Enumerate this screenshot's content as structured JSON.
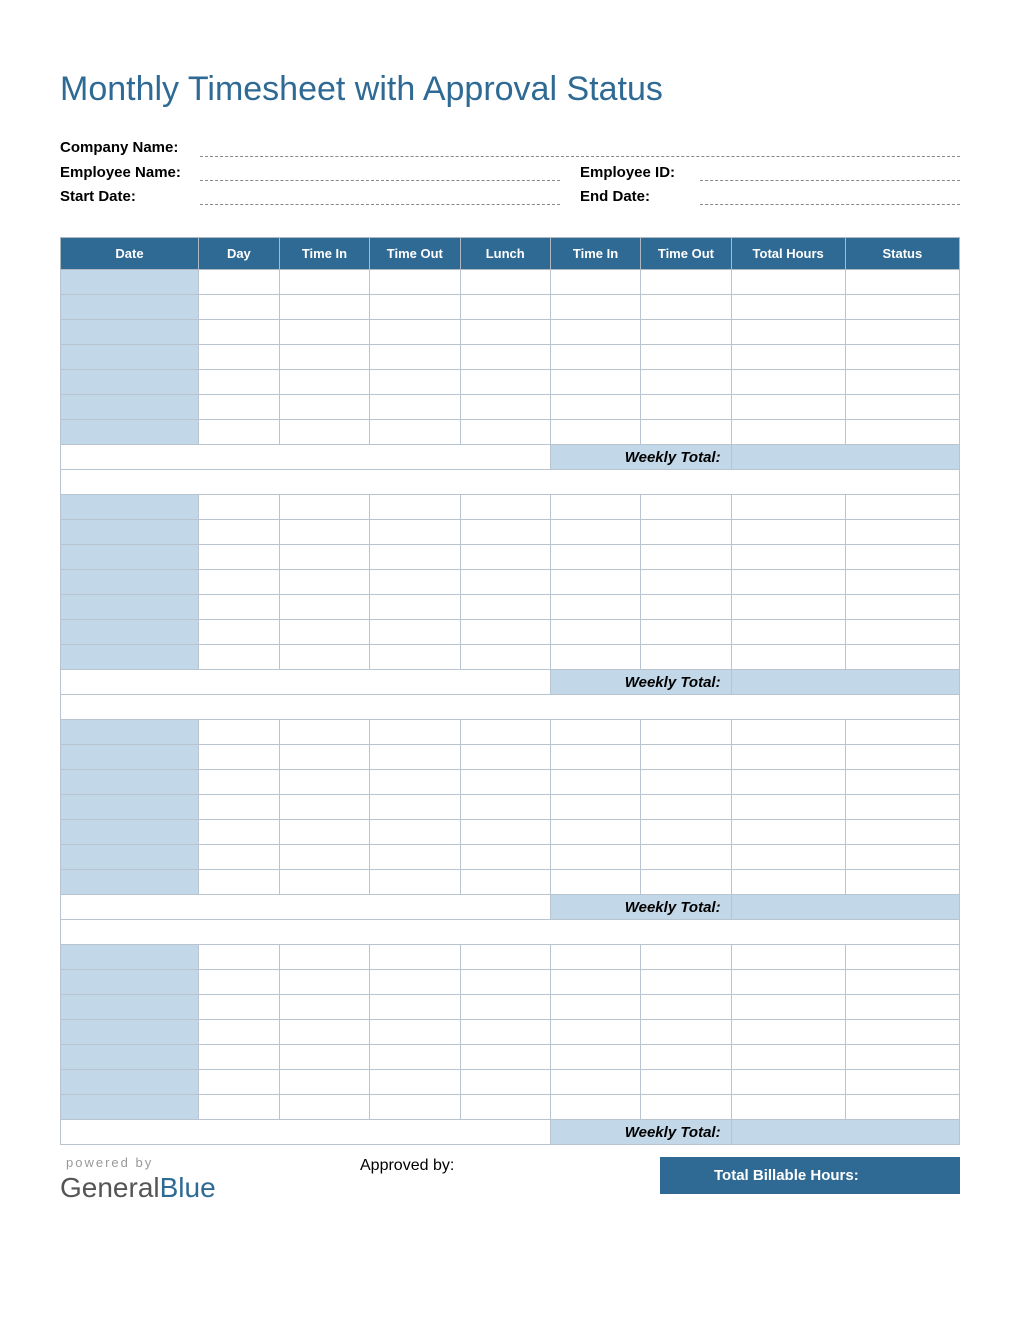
{
  "title": "Monthly Timesheet with Approval Status",
  "fields": {
    "company_label": "Company Name:",
    "company_value": "",
    "employee_label": "Employee Name:",
    "employee_value": "",
    "employee_id_label": "Employee ID:",
    "employee_id_value": "",
    "start_date_label": "Start Date:",
    "start_date_value": "",
    "end_date_label": "End Date:",
    "end_date_value": ""
  },
  "columns": [
    "Date",
    "Day",
    "Time In",
    "Time Out",
    "Lunch",
    "Time In",
    "Time Out",
    "Total Hours",
    "Status"
  ],
  "weeks": [
    {
      "rows": 7,
      "weekly_total_label": "Weekly Total:",
      "weekly_total_value": ""
    },
    {
      "rows": 7,
      "weekly_total_label": "Weekly Total:",
      "weekly_total_value": ""
    },
    {
      "rows": 7,
      "weekly_total_label": "Weekly Total:",
      "weekly_total_value": ""
    },
    {
      "rows": 7,
      "weekly_total_label": "Weekly Total:",
      "weekly_total_value": ""
    }
  ],
  "footer": {
    "powered_by": "powered by",
    "brand_a": "General",
    "brand_b": "Blue",
    "approved_by_label": "Approved by:",
    "approved_by_value": "",
    "total_billable_label": "Total Billable Hours:",
    "total_billable_value": ""
  }
}
